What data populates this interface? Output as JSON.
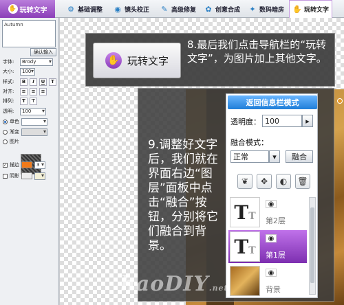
{
  "toolbar": {
    "app_tab": "玩转文字",
    "items": [
      {
        "label": "基础调整",
        "icon": "adjust-icon"
      },
      {
        "label": "镜头校正",
        "icon": "lens-icon"
      },
      {
        "label": "高级修复",
        "icon": "repair-icon"
      },
      {
        "label": "创意合成",
        "icon": "composite-icon"
      },
      {
        "label": "数码暗房",
        "icon": "darkroom-icon"
      },
      {
        "label": "玩转文字",
        "icon": "hand-text-icon"
      }
    ]
  },
  "left_panel": {
    "text_value": "Autumn",
    "insert_button": "确认输入",
    "font_label": "字体:",
    "font_value": "Brody",
    "size_label": "大小:",
    "size_value": "100",
    "style_label": "样式:",
    "style_buttons": [
      "B",
      "I",
      "U",
      "T"
    ],
    "align_label": "对齐:",
    "align_buttons": [
      "≡",
      "≡",
      "≡"
    ],
    "layout_label": "排列:",
    "opacity_label": "透明:",
    "opacity_value": "100",
    "mode_solid": "单色",
    "mode_gradient": "渐变",
    "mode_image": "图片",
    "stroke_label": "描边",
    "stroke_color": "#f07a1a",
    "stroke_width": "3",
    "shadow_label": "阴影"
  },
  "callout8": {
    "button_label": "玩转文字",
    "text": "8.最后我们点击导航栏的“玩转文字”，为图片加上其他文字。"
  },
  "callout9": {
    "text": "9.调整好文字后，我们就在界面右边“图层”面板中点击“融合”按钮，分别将它们融合到背景。"
  },
  "layer_panel": {
    "back_button": "返回信息栏模式",
    "opacity_label": "透明度：",
    "opacity_value": "100",
    "blend_label": "融合模式：",
    "blend_value": "正常",
    "blend_button": "融合",
    "layers": [
      {
        "name": "第2层",
        "active": false
      },
      {
        "name": "第1层",
        "active": true
      },
      {
        "name": "背景",
        "active": false
      }
    ]
  },
  "watermark": {
    "main": "haoDIY",
    "suffix": ".net"
  }
}
